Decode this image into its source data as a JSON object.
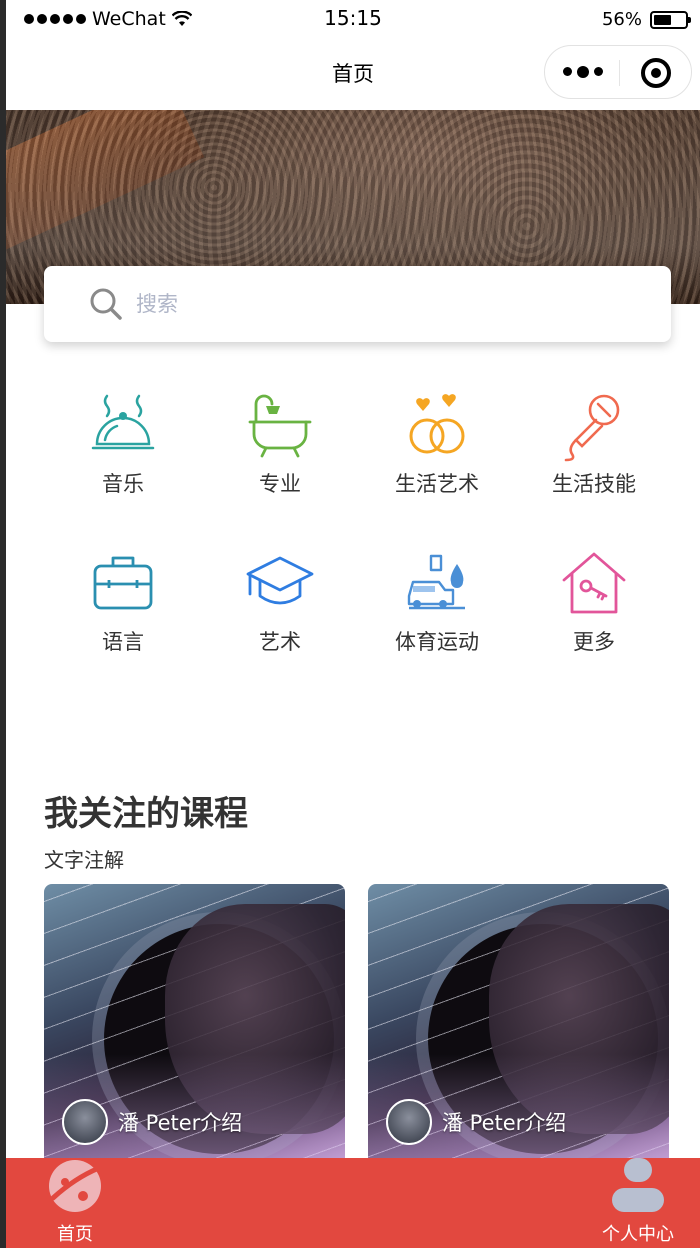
{
  "status_bar": {
    "carrier": "WeChat",
    "time": "15:15",
    "battery": "56%",
    "battery_level": 0.56
  },
  "nav": {
    "title": "首页"
  },
  "search": {
    "placeholder": "搜索"
  },
  "categories": [
    {
      "label": "音乐",
      "icon": "cloche-icon",
      "color": "#2aa3a0"
    },
    {
      "label": "专业",
      "icon": "bathtub-icon",
      "color": "#69b342"
    },
    {
      "label": "生活艺术",
      "icon": "rings-icon",
      "color": "#f5a623"
    },
    {
      "label": "生活技能",
      "icon": "microphone-icon",
      "color": "#f06a4f"
    },
    {
      "label": "语言",
      "icon": "briefcase-icon",
      "color": "#2a8fb0"
    },
    {
      "label": "艺术",
      "icon": "graduation-cap-icon",
      "color": "#2f7de1"
    },
    {
      "label": "体育运动",
      "icon": "car-wash-icon",
      "color": "#4a8fd6"
    },
    {
      "label": "更多",
      "icon": "house-key-icon",
      "color": "#e2559a"
    }
  ],
  "section": {
    "title": "我关注的课程",
    "subtitle": "文字注解"
  },
  "courses": [
    {
      "author": "潘 Peter介绍"
    },
    {
      "author": "潘 Peter介绍"
    }
  ],
  "tabbar": {
    "background": "#e2483f",
    "items": [
      {
        "label": "首页",
        "icon": "planet-icon"
      },
      {
        "label": "个人中心",
        "icon": "person-icon"
      }
    ]
  }
}
